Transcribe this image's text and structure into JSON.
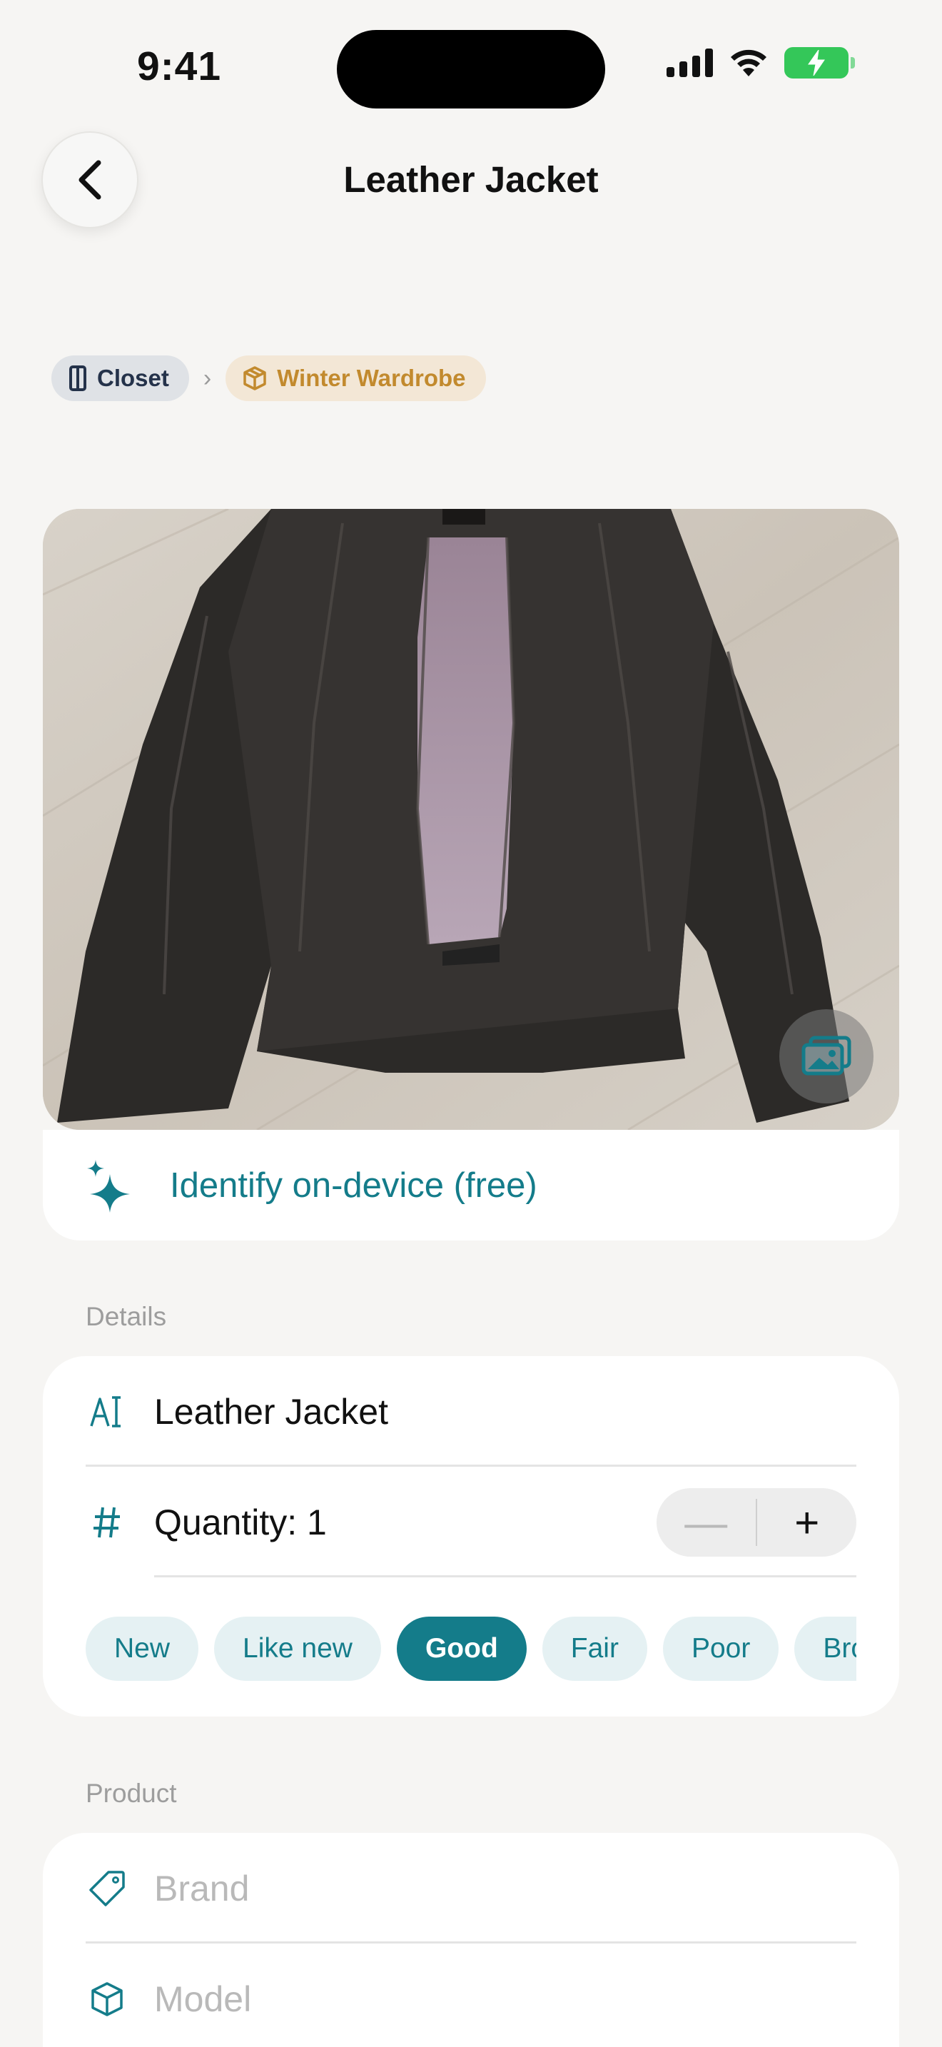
{
  "status_bar": {
    "time": "9:41"
  },
  "nav": {
    "title": "Leather Jacket"
  },
  "breadcrumb": {
    "items": [
      {
        "label": "Closet",
        "icon": "closet-icon"
      },
      {
        "label": "Winter Wardrobe",
        "icon": "box-icon"
      }
    ]
  },
  "photo": {
    "alt_icon": "photo-library-icon"
  },
  "identify": {
    "label": "Identify on-device (free)",
    "icon": "sparkles-icon"
  },
  "details": {
    "section_label": "Details",
    "name_value": "Leather Jacket",
    "quantity_label": "Quantity: 1",
    "stepper_minus": "—",
    "stepper_plus": "+",
    "conditions": [
      "New",
      "Like new",
      "Good",
      "Fair",
      "Poor",
      "Broken"
    ],
    "selected_condition": "Good"
  },
  "product": {
    "section_label": "Product",
    "brand_placeholder": "Brand",
    "model_placeholder": "Model"
  },
  "colors": {
    "accent": "#147c8a",
    "background": "#f6f5f3",
    "closet_chip": "#dfe2e6",
    "winter_chip": "#f3e7d6",
    "winter_text": "#c28a2e"
  }
}
